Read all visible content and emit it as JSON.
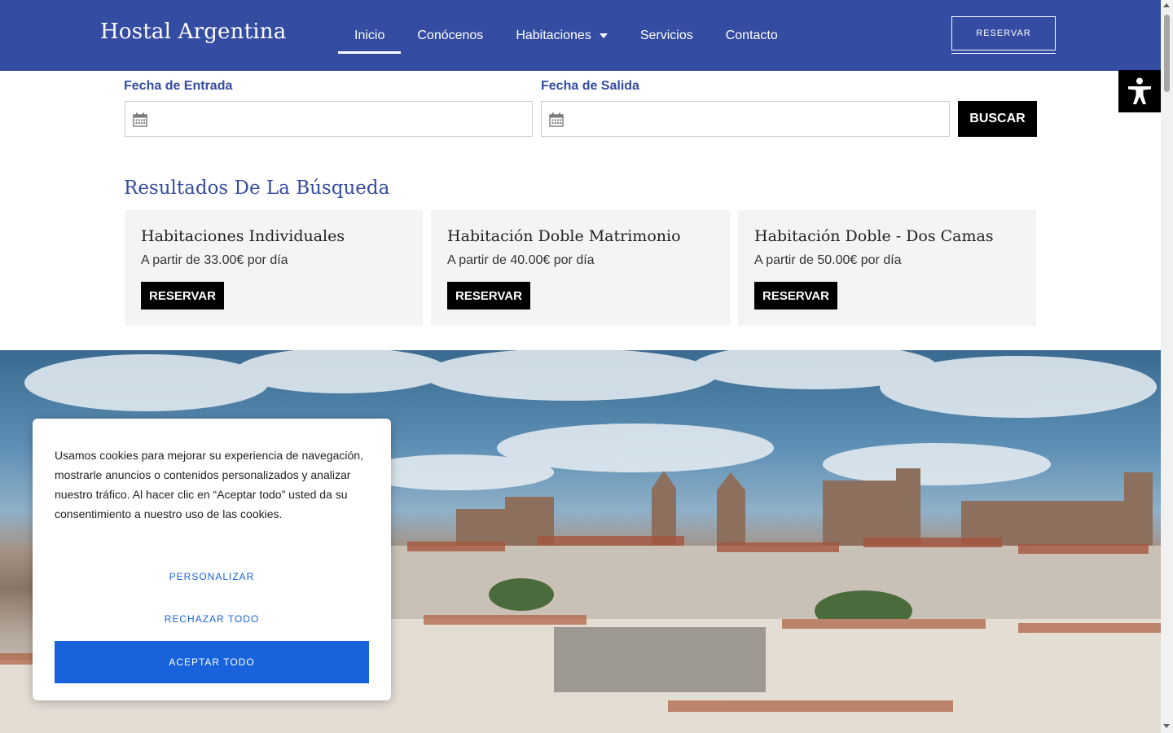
{
  "header": {
    "logo": "Hostal Argentina",
    "nav": [
      {
        "label": "Inicio",
        "active": true
      },
      {
        "label": "Conócenos"
      },
      {
        "label": "Habitaciones",
        "has_dropdown": true
      },
      {
        "label": "Servicios"
      },
      {
        "label": "Contacto"
      }
    ],
    "cta_label": "RESERVAR",
    "brand_color": "#344ca1"
  },
  "accessibility": {
    "icon": "accessibility-icon"
  },
  "search": {
    "checkin_label": "Fecha de Entrada",
    "checkin_value": "",
    "checkout_label": "Fecha de Salida",
    "checkout_value": "",
    "input_icon": "calendar-icon",
    "button_label": "BUSCAR"
  },
  "results": {
    "title": "Resultados De La Búsqueda",
    "rooms": [
      {
        "name": "Habitaciones Individuales",
        "price": "A partir de 33.00€ por día",
        "button": "RESERVAR"
      },
      {
        "name": "Habitación Doble Matrimonio",
        "price": "A partir de 40.00€ por día",
        "button": "RESERVAR"
      },
      {
        "name": "Habitación Doble - Dos Camas",
        "price": "A partir de 50.00€ por día",
        "button": "RESERVAR"
      }
    ]
  },
  "cookie": {
    "text": "Usamos cookies para mejorar su experiencia de navegación, mostrarle anuncios o contenidos personalizados y analizar nuestro tráfico. Al hacer clic en “Aceptar todo” usted da su consentimiento a nuestro uso de las cookies.",
    "customize": "PERSONALIZAR",
    "reject": "RECHAZAR TODO",
    "accept": "ACEPTAR TODO",
    "accent_color": "#1863dc"
  }
}
